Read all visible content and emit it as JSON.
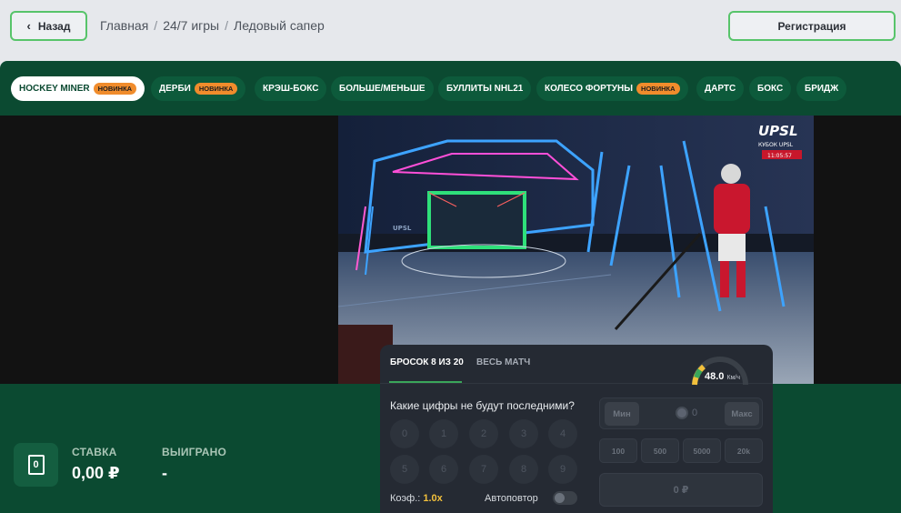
{
  "header": {
    "back_label": "Назад",
    "breadcrumbs": [
      "Главная",
      "24/7 игры",
      "Ледовый сапер"
    ],
    "breadcrumb_separator": "/",
    "register_label": "Регистрация"
  },
  "game_tabs": [
    {
      "label": "HOCKEY MINER",
      "badge": "НОВИНКА",
      "active": true
    },
    {
      "label": "ДЕРБИ",
      "badge": "НОВИНКА",
      "active": false
    },
    {
      "label": "КРЭШ-БОКС",
      "badge": "",
      "active": false
    },
    {
      "label": "БОЛЬШЕ/МЕНЬШЕ",
      "badge": "",
      "active": false
    },
    {
      "label": "БУЛЛИТЫ NHL21",
      "badge": "",
      "active": false
    },
    {
      "label": "КОЛЕСО ФОРТУНЫ",
      "badge": "НОВИНКА",
      "active": false
    },
    {
      "label": "ДАРТС",
      "badge": "",
      "active": false
    },
    {
      "label": "БОКС",
      "badge": "",
      "active": false
    },
    {
      "label": "БРИДЖ",
      "badge": "",
      "active": false
    }
  ],
  "video": {
    "logo": "UPSL",
    "cup_label": "КУБОК UPSL",
    "live_time": "11:05:57",
    "rink_banner": "UPSL"
  },
  "bet_summary": {
    "stake_label": "СТАВКА",
    "stake_value": "0,00 ₽",
    "won_label": "ВЫИГРАНО",
    "won_value": "-",
    "icon_glyph": "0"
  },
  "panel": {
    "tabs": [
      "БРОСОК 8 ИЗ 20",
      "ВЕСЬ МАТЧ"
    ],
    "active_tab": 0,
    "speed_value": "48.0",
    "speed_unit": "Км/ч",
    "question": "Какие цифры не будут последними?",
    "numbers": [
      "0",
      "1",
      "2",
      "3",
      "4",
      "5",
      "6",
      "7",
      "8",
      "9"
    ],
    "coef_label": "Коэф.:",
    "coef_value": "1.0x",
    "autorepeat_label": "Автоповтор",
    "autorepeat_on": false,
    "min_label": "Мин",
    "max_label": "Макс",
    "stake_input": "0",
    "quick_amounts": [
      "100",
      "500",
      "5000",
      "20k"
    ],
    "place_button": "0 ₽"
  },
  "colors": {
    "brand_green": "#0b4a31",
    "accent_green": "#57c46a",
    "badge_orange": "#f08c2c",
    "coef_yellow": "#f2c03c"
  }
}
